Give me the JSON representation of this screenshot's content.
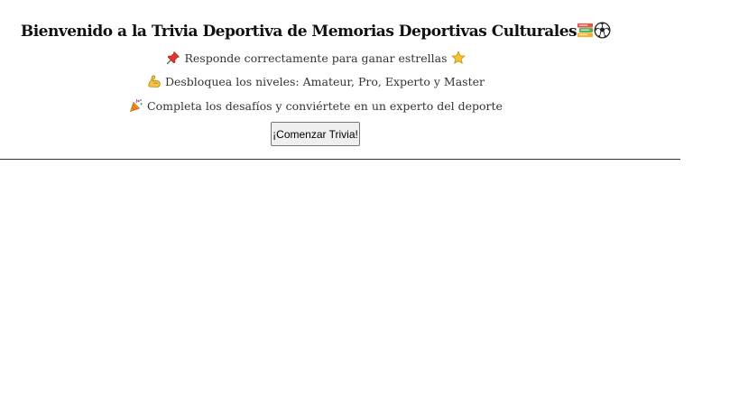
{
  "welcome": {
    "title": "Bienvenido a la Trivia Deportiva de Memorias Deportivas Culturales",
    "title_icons": [
      "books-icon",
      "soccer-ball-icon"
    ],
    "lines": [
      {
        "icon": "pushpin-icon",
        "text": "Responde correctamente para ganar estrellas",
        "trailing_icon": "star-icon"
      },
      {
        "icon": "flexed-biceps-icon",
        "text": "Desbloquea los niveles: Amateur, Pro, Experto y Master"
      },
      {
        "icon": "party-popper-icon",
        "text": "Completa los desafíos y conviértete en un experto del deporte"
      }
    ],
    "start_button": "¡Comenzar Trivia!"
  }
}
